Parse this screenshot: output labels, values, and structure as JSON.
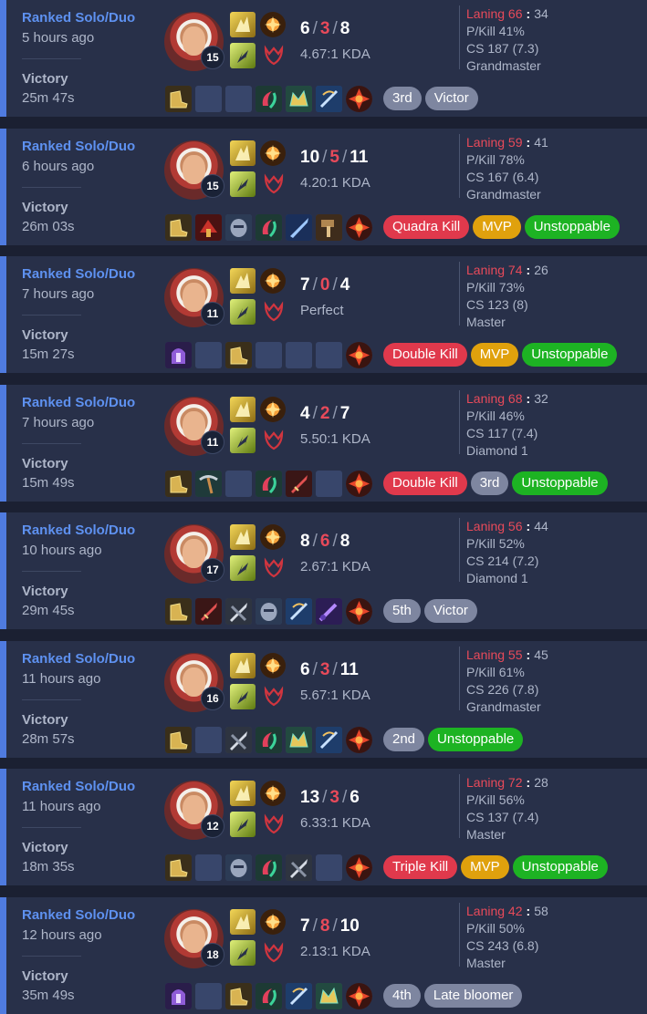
{
  "matches": [
    {
      "queue": "Ranked Solo/Duo",
      "time": "5 hours ago",
      "result": "Victory",
      "duration": "25m 47s",
      "level": "15",
      "kills": "6",
      "deaths": "3",
      "assists": "8",
      "kda": "4.67:1 KDA",
      "laning_label": "Laning 66",
      "laning_opp": "34",
      "pkill": "P/Kill 41%",
      "cs": "CS 187 (7.3)",
      "rank": "Grandmaster",
      "items": [
        "boots",
        "empty",
        "empty",
        "green-crescent",
        "crown",
        "bow",
        "role"
      ],
      "badges": [
        {
          "text": "3rd",
          "color": "grey"
        },
        {
          "text": "Victor",
          "color": "grey"
        }
      ]
    },
    {
      "queue": "Ranked Solo/Duo",
      "time": "6 hours ago",
      "result": "Victory",
      "duration": "26m 03s",
      "level": "15",
      "kills": "10",
      "deaths": "5",
      "assists": "11",
      "kda": "4.20:1 KDA",
      "laning_label": "Laning 59",
      "laning_opp": "41",
      "pkill": "P/Kill 78%",
      "cs": "CS 167 (6.4)",
      "rank": "Grandmaster",
      "items": [
        "boots",
        "red-hydra",
        "grey-mask",
        "green-crescent",
        "blue-blade",
        "hammer",
        "role"
      ],
      "badges": [
        {
          "text": "Quadra Kill",
          "color": "red"
        },
        {
          "text": "MVP",
          "color": "gold"
        },
        {
          "text": "Unstoppable",
          "color": "green"
        }
      ]
    },
    {
      "queue": "Ranked Solo/Duo",
      "time": "7 hours ago",
      "result": "Victory",
      "duration": "15m 27s",
      "level": "11",
      "kills": "7",
      "deaths": "0",
      "assists": "4",
      "kda": "Perfect",
      "laning_label": "Laning 74",
      "laning_opp": "26",
      "pkill": "P/Kill 73%",
      "cs": "CS 123 (8)",
      "rank": "Master",
      "items": [
        "purple-helm",
        "empty",
        "boots",
        "empty",
        "empty",
        "empty",
        "role"
      ],
      "badges": [
        {
          "text": "Double Kill",
          "color": "red"
        },
        {
          "text": "MVP",
          "color": "gold"
        },
        {
          "text": "Unstoppable",
          "color": "green"
        }
      ]
    },
    {
      "queue": "Ranked Solo/Duo",
      "time": "7 hours ago",
      "result": "Victory",
      "duration": "15m 49s",
      "level": "11",
      "kills": "4",
      "deaths": "2",
      "assists": "7",
      "kda": "5.50:1 KDA",
      "laning_label": "Laning 68",
      "laning_opp": "32",
      "pkill": "P/Kill 46%",
      "cs": "CS 117 (7.4)",
      "rank": "Diamond 1",
      "items": [
        "boots",
        "pickaxe",
        "empty",
        "green-crescent",
        "red-sword",
        "empty",
        "role"
      ],
      "badges": [
        {
          "text": "Double Kill",
          "color": "red"
        },
        {
          "text": "3rd",
          "color": "grey"
        },
        {
          "text": "Unstoppable",
          "color": "green"
        }
      ]
    },
    {
      "queue": "Ranked Solo/Duo",
      "time": "10 hours ago",
      "result": "Victory",
      "duration": "29m 45s",
      "level": "17",
      "kills": "8",
      "deaths": "6",
      "assists": "8",
      "kda": "2.67:1 KDA",
      "laning_label": "Laning 56",
      "laning_opp": "44",
      "pkill": "P/Kill 52%",
      "cs": "CS 214 (7.2)",
      "rank": "Diamond 1",
      "items": [
        "boots",
        "red-sword",
        "grey-blade",
        "grey-mask",
        "bow",
        "purple-blade",
        "role"
      ],
      "badges": [
        {
          "text": "5th",
          "color": "grey"
        },
        {
          "text": "Victor",
          "color": "grey"
        }
      ]
    },
    {
      "queue": "Ranked Solo/Duo",
      "time": "11 hours ago",
      "result": "Victory",
      "duration": "28m 57s",
      "level": "16",
      "kills": "6",
      "deaths": "3",
      "assists": "11",
      "kda": "5.67:1 KDA",
      "laning_label": "Laning 55",
      "laning_opp": "45",
      "pkill": "P/Kill 61%",
      "cs": "CS 226 (7.8)",
      "rank": "Grandmaster",
      "items": [
        "boots",
        "empty",
        "grey-blade",
        "green-crescent",
        "crown",
        "bow",
        "role"
      ],
      "badges": [
        {
          "text": "2nd",
          "color": "grey"
        },
        {
          "text": "Unstoppable",
          "color": "green"
        }
      ]
    },
    {
      "queue": "Ranked Solo/Duo",
      "time": "11 hours ago",
      "result": "Victory",
      "duration": "18m 35s",
      "level": "12",
      "kills": "13",
      "deaths": "3",
      "assists": "6",
      "kda": "6.33:1 KDA",
      "laning_label": "Laning 72",
      "laning_opp": "28",
      "pkill": "P/Kill 56%",
      "cs": "CS 137 (7.4)",
      "rank": "Master",
      "items": [
        "boots",
        "empty",
        "grey-mask",
        "green-crescent",
        "grey-blade",
        "empty",
        "role"
      ],
      "badges": [
        {
          "text": "Triple Kill",
          "color": "red"
        },
        {
          "text": "MVP",
          "color": "gold"
        },
        {
          "text": "Unstoppable",
          "color": "green"
        }
      ]
    },
    {
      "queue": "Ranked Solo/Duo",
      "time": "12 hours ago",
      "result": "Victory",
      "duration": "35m 49s",
      "level": "18",
      "kills": "7",
      "deaths": "8",
      "assists": "10",
      "kda": "2.13:1 KDA",
      "laning_label": "Laning 42",
      "laning_opp": "58",
      "pkill": "P/Kill 50%",
      "cs": "CS 243 (6.8)",
      "rank": "Master",
      "items": [
        "purple-helm",
        "empty",
        "boots",
        "green-crescent",
        "bow",
        "crown",
        "role"
      ],
      "badges": [
        {
          "text": "4th",
          "color": "grey"
        },
        {
          "text": "Late bloomer",
          "color": "grey"
        }
      ]
    }
  ],
  "colors": {
    "accent": "#4f7be0",
    "queue": "#5e91f0",
    "death": "#e84a5a",
    "badge_grey": "#7e86a0",
    "badge_red": "#e0394c",
    "badge_gold": "#e0a10d",
    "badge_green": "#1db323"
  }
}
